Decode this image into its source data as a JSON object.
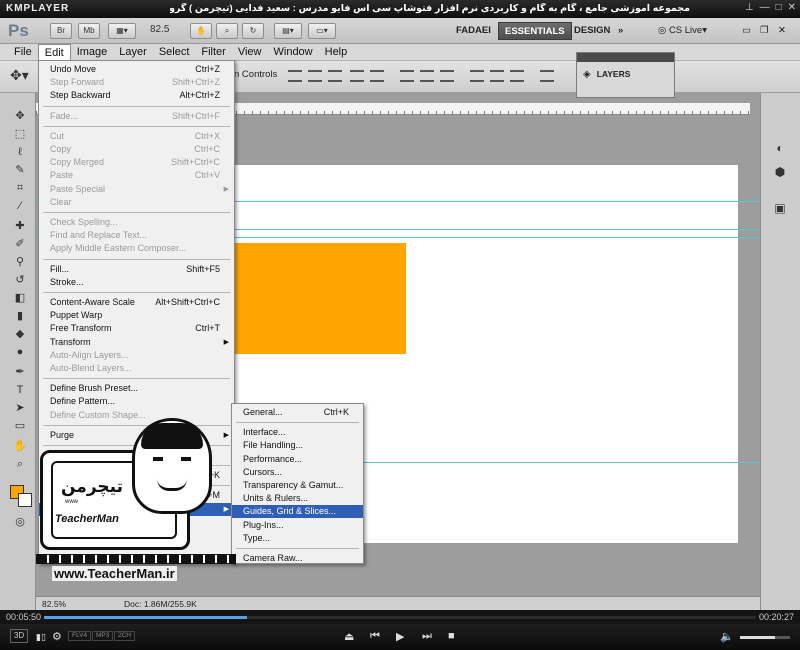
{
  "player": {
    "logo": "KMPLAYER",
    "title": "مجموعه آموزشی جامع ، گام به گام و کاربردی نرم افزار فتوشاپ سی اس فایو  مدرس : سعید فدایی (تیچرمن ) گروه آموزشی پادشاه گرافیست ها",
    "time_elapsed": "00:05:50",
    "time_total": "00:20:27",
    "progress_fraction": 0.285,
    "volume_fraction": 0.7,
    "badge_3d": "3D",
    "formats": [
      "FLV4",
      "MP3",
      "2CH"
    ]
  },
  "appbar": {
    "logo": "Ps",
    "br_label": "Br",
    "mb_label": "Mb",
    "zoom": "82.5",
    "workspaces": [
      "FADAEI",
      "ESSENTIALS",
      "DESIGN"
    ],
    "active_workspace": "ESSENTIALS",
    "cs_live": "CS Live"
  },
  "menubar": [
    "File",
    "Edit",
    "Image",
    "Layer",
    "Select",
    "Filter",
    "View",
    "Window",
    "Help"
  ],
  "options": {
    "controls_label": "n Controls"
  },
  "layers_panel": {
    "title": "LAYERS"
  },
  "edit_menu": {
    "items": [
      {
        "label": "Undo Move",
        "shortcut": "Ctrl+Z",
        "disabled": false
      },
      {
        "label": "Step Forward",
        "shortcut": "Shift+Ctrl+Z",
        "disabled": true
      },
      {
        "label": "Step Backward",
        "shortcut": "Alt+Ctrl+Z",
        "disabled": false
      },
      {
        "label": "Fade...",
        "shortcut": "Shift+Ctrl+F",
        "disabled": true
      },
      {
        "label": "Cut",
        "shortcut": "Ctrl+X",
        "disabled": true
      },
      {
        "label": "Copy",
        "shortcut": "Ctrl+C",
        "disabled": true
      },
      {
        "label": "Copy Merged",
        "shortcut": "Shift+Ctrl+C",
        "disabled": true
      },
      {
        "label": "Paste",
        "shortcut": "Ctrl+V",
        "disabled": true
      },
      {
        "label": "Paste Special",
        "shortcut": "",
        "disabled": true,
        "submenu": true
      },
      {
        "label": "Clear",
        "shortcut": "",
        "disabled": true
      },
      {
        "label": "Check Spelling...",
        "shortcut": "",
        "disabled": true
      },
      {
        "label": "Find and Replace Text...",
        "shortcut": "",
        "disabled": true
      },
      {
        "label": "Apply Middle Eastern Composer...",
        "shortcut": "",
        "disabled": true
      },
      {
        "label": "Fill...",
        "shortcut": "Shift+F5",
        "disabled": false
      },
      {
        "label": "Stroke...",
        "shortcut": "",
        "disabled": false
      },
      {
        "label": "Content-Aware Scale",
        "shortcut": "Alt+Shift+Ctrl+C",
        "disabled": false
      },
      {
        "label": "Puppet Warp",
        "shortcut": "",
        "disabled": false
      },
      {
        "label": "Free Transform",
        "shortcut": "Ctrl+T",
        "disabled": false
      },
      {
        "label": "Transform",
        "shortcut": "",
        "disabled": false,
        "submenu": true
      },
      {
        "label": "Auto-Align Layers...",
        "shortcut": "",
        "disabled": true
      },
      {
        "label": "Auto-Blend Layers...",
        "shortcut": "",
        "disabled": true
      },
      {
        "label": "Define Brush Preset...",
        "shortcut": "",
        "disabled": false
      },
      {
        "label": "Define Pattern...",
        "shortcut": "",
        "disabled": false
      },
      {
        "label": "Define Custom Shape...",
        "shortcut": "",
        "disabled": true
      },
      {
        "label": "Purge",
        "shortcut": "",
        "disabled": false,
        "submenu": true
      },
      {
        "label": "dobe PDF Prese",
        "shortcut": "",
        "disabled": false
      },
      {
        "label": "",
        "shortcut": "+Ctrl+K",
        "disabled": false
      },
      {
        "label": "Menus...",
        "shortcut": "Alt+Shift+Ctrl+M",
        "disabled": false
      },
      {
        "label": "Preferences",
        "shortcut": "",
        "disabled": false,
        "submenu": true,
        "highlighted": true
      }
    ]
  },
  "preferences_menu": {
    "items": [
      {
        "label": "General...",
        "shortcut": "Ctrl+K"
      },
      {
        "label": "Interface..."
      },
      {
        "label": "File Handling..."
      },
      {
        "label": "Performance..."
      },
      {
        "label": "Cursors..."
      },
      {
        "label": "Transparency & Gamut..."
      },
      {
        "label": "Units & Rulers..."
      },
      {
        "label": "Guides, Grid & Slices...",
        "highlighted": true
      },
      {
        "label": "Plug-Ins..."
      },
      {
        "label": "Type..."
      },
      {
        "label": "Camera Raw..."
      }
    ]
  },
  "status": {
    "zoom": "82.5%",
    "doc": "Doc: 1.86M/255.9K"
  },
  "watermark": {
    "logo_fa": "تیچرمن",
    "tagline": "TeacherMan",
    "url": "www.TeacherMan.ir"
  },
  "colors": {
    "foreground": "#ffa500",
    "accent": "#2f5fb5",
    "guide": "#59c6d6"
  },
  "icons": [
    "move-icon",
    "marquee-icon",
    "lasso-icon",
    "quick-select-icon",
    "crop-icon",
    "eyedropper-icon",
    "healing-icon",
    "brush-icon",
    "stamp-icon",
    "history-brush-icon",
    "eraser-icon",
    "gradient-icon",
    "blur-icon",
    "dodge-icon",
    "pen-icon",
    "type-icon",
    "path-select-icon",
    "shape-icon",
    "hand-icon",
    "zoom-icon"
  ]
}
